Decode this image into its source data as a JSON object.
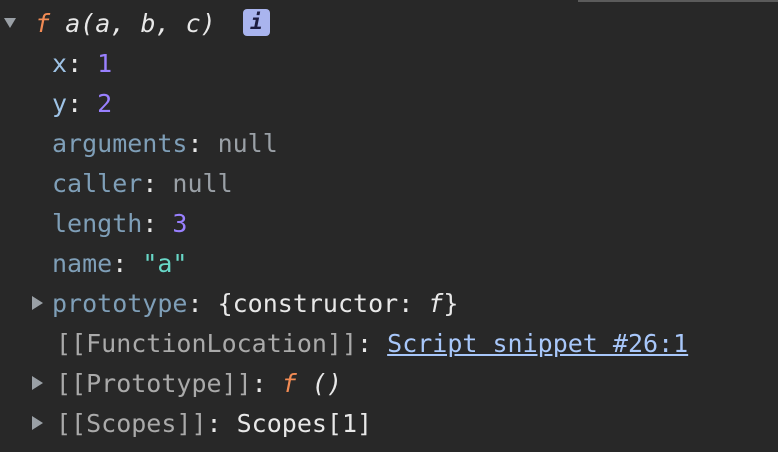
{
  "function_header": {
    "f_symbol": "f",
    "signature": "a(a, b, c)",
    "info_badge": "i"
  },
  "properties": [
    {
      "key": "x",
      "sep": ": ",
      "value": "1",
      "type": "number"
    },
    {
      "key": "y",
      "sep": ": ",
      "value": "2",
      "type": "number"
    },
    {
      "key": "arguments",
      "sep": ": ",
      "value": "null",
      "type": "null"
    },
    {
      "key": "caller",
      "sep": ": ",
      "value": "null",
      "type": "null"
    },
    {
      "key": "length",
      "sep": ": ",
      "value": "3",
      "type": "number"
    },
    {
      "key": "name",
      "sep": ": ",
      "value": "\"a\"",
      "type": "string"
    }
  ],
  "prototype": {
    "key": "prototype",
    "sep": ": ",
    "value_prefix": "{constructor: ",
    "value_f": "f",
    "value_suffix": "}"
  },
  "function_location": {
    "key": "[[FunctionLocation]]",
    "sep": ": ",
    "link": "Script snippet #26:1"
  },
  "proto_internal": {
    "key": "[[Prototype]]",
    "sep": ": ",
    "value_f": "f",
    "value_suffix": " ()"
  },
  "scopes": {
    "key": "[[Scopes]]",
    "sep": ": ",
    "value": "Scopes[1]"
  },
  "colors": {
    "background": "#282828",
    "key": "#9ec3e6",
    "number": "#9980ff",
    "null": "#9aa0a6",
    "string": "#68d8c8",
    "function_symbol": "#f28b54",
    "link": "#a8c7fa"
  },
  "icons": {
    "expanded": "triangle-down-icon",
    "collapsed": "triangle-right-icon",
    "info": "info-icon"
  }
}
